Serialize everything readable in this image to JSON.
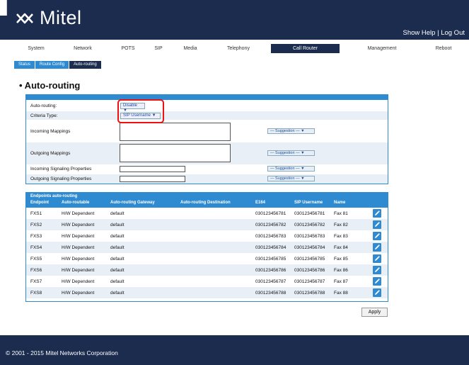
{
  "header": {
    "brand": "Mitel",
    "show_help": "Show Help",
    "separator": "|",
    "logout": "Log Out"
  },
  "mainnav": [
    "System",
    "Network",
    "POTS",
    "SIP",
    "Media",
    "Telephony",
    "Call Router",
    "Management",
    "Reboot"
  ],
  "subnav": [
    "Status",
    "Route Config",
    "Auto-routing"
  ],
  "page_title": "• Auto-routing",
  "settings": {
    "auto_routing_label": "Auto-routing:",
    "auto_routing_value": "Disable",
    "criteria_label": "Criteria Type:",
    "criteria_value": "SIP Username",
    "incoming_mappings_label": "Incoming Mappings",
    "outgoing_mappings_label": "Outgoing Mappings",
    "incoming_signaling_label": "Incoming Signaling Properties",
    "outgoing_signaling_label": "Outgoing Signaling Properties",
    "suggestion": "— Suggestion — ▼"
  },
  "endpoints": {
    "caption": "Endpoints auto-routing",
    "columns": [
      "Endpoint",
      "Auto-routable",
      "Auto-routing Gateway",
      "Auto-routing Destination",
      "E164",
      "SIP Username",
      "Name"
    ],
    "rows": [
      [
        "FXS1",
        "H/W Dependent",
        "default",
        "",
        "030123456781",
        "030123456781",
        "Fax 81"
      ],
      [
        "FXS2",
        "H/W Dependent",
        "default",
        "",
        "030123456782",
        "030123456782",
        "Fax 82"
      ],
      [
        "FXS3",
        "H/W Dependent",
        "default",
        "",
        "030123456783",
        "030123456783",
        "Fax 83"
      ],
      [
        "FXS4",
        "H/W Dependent",
        "default",
        "",
        "030123456784",
        "030123456784",
        "Fax 84"
      ],
      [
        "FXS5",
        "H/W Dependent",
        "default",
        "",
        "030123456785",
        "030123456785",
        "Fax 85"
      ],
      [
        "FXS6",
        "H/W Dependent",
        "default",
        "",
        "030123456786",
        "030123456786",
        "Fax 86"
      ],
      [
        "FXS7",
        "H/W Dependent",
        "default",
        "",
        "030123456787",
        "030123456787",
        "Fax 87"
      ],
      [
        "FXS8",
        "H/W Dependent",
        "default",
        "",
        "030123456788",
        "030123456788",
        "Fax 88"
      ]
    ]
  },
  "apply_label": "Apply",
  "footer": "© 2001 - 2015 Mitel Networks Corporation",
  "colors": {
    "navy": "#1b2c4f",
    "accent": "#2e8ad1",
    "highlight": "#e11111"
  },
  "icons": {
    "logo": "mitel-logo-icon",
    "edit": "pencil-icon",
    "dropdown": "triangle-down-icon"
  }
}
